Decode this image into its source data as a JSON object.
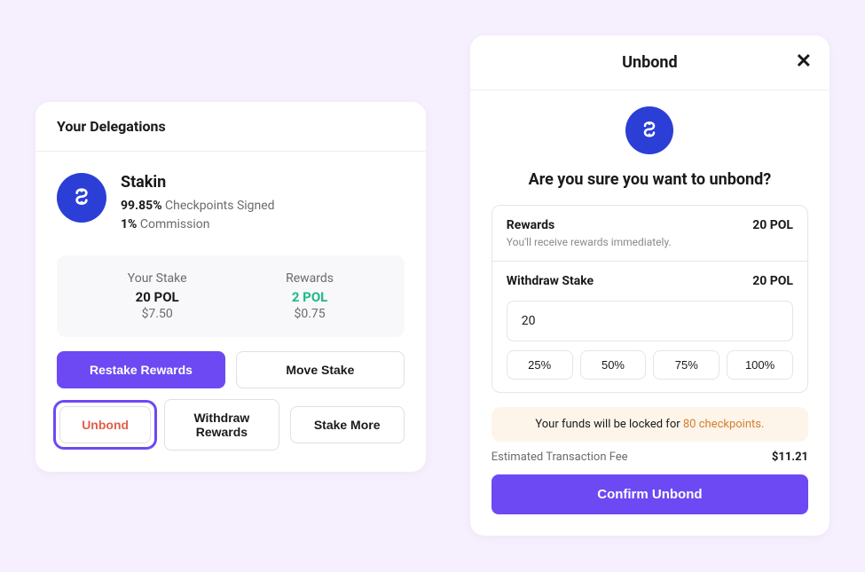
{
  "delegations": {
    "title": "Your Delegations",
    "validator": {
      "name": "Stakin",
      "checkpoints_pct": "99.85%",
      "checkpoints_label": " Checkpoints Signed",
      "commission_pct": "1%",
      "commission_label": " Commission"
    },
    "stake": {
      "your_stake_label": "Your Stake",
      "your_stake_value": "20 POL",
      "your_stake_usd": "$7.50",
      "rewards_label": "Rewards",
      "rewards_value": "2 POL",
      "rewards_usd": "$0.75"
    },
    "buttons": {
      "restake": "Restake Rewards",
      "move": "Move Stake",
      "unbond": "Unbond",
      "withdraw": "Withdraw Rewards",
      "stake_more": "Stake More"
    }
  },
  "modal": {
    "title": "Unbond",
    "question": "Are you sure you want to unbond?",
    "rewards_label": "Rewards",
    "rewards_value": "20 POL",
    "rewards_sub": "You'll receive rewards immediately.",
    "withdraw_label": "Withdraw Stake",
    "withdraw_value": "20 POL",
    "amount_input": "20",
    "pct": {
      "p25": "25%",
      "p50": "50%",
      "p75": "75%",
      "p100": "100%"
    },
    "warning_prefix": "Your funds will be locked for ",
    "warning_highlight": "80 checkpoints.",
    "fee_label": "Estimated Transaction Fee",
    "fee_value": "$11.21",
    "confirm": "Confirm Unbond"
  }
}
